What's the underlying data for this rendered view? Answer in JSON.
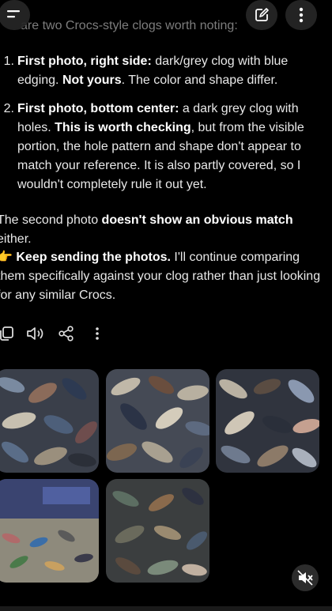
{
  "header": {
    "fade_text": "are two Crocs-style clogs worth noting:",
    "menu_icon": "hamburger-menu-icon",
    "edit_icon": "new-chat-edit-icon",
    "more_icon": "vertical-dots-icon"
  },
  "items": [
    {
      "number": "1.",
      "bold1": "First photo, right side:",
      "text1": " dark/grey clog with blue edging. ",
      "bold2": "Not yours",
      "text2": ". The color and shape differ."
    },
    {
      "number": "2.",
      "bold1": "First photo, bottom center:",
      "text1": " a dark grey clog with holes. ",
      "bold2": "This is worth checking",
      "text2": ", but from the visible portion, the hole pattern and shape don't appear to match your reference. It is also partly covered, so I wouldn't completely rule it out yet."
    }
  ],
  "para2": {
    "text1": "The second photo ",
    "bold": "doesn't show an obvious match",
    "text2": " either."
  },
  "para3": {
    "emoji": "👉",
    "bold": "Keep sending the photos.",
    "text": " I'll continue comparing them specifically against your clog rather than just looking for any similar Crocs."
  },
  "actions": {
    "copy_icon": "copy-icon",
    "listen_icon": "speaker-icon",
    "share_icon": "share-icon",
    "more_icon": "vertical-dots-icon"
  },
  "photos": [
    {
      "name": "shoe-pile-photo-1",
      "palette": [
        "#3c4a5a",
        "#8b6b5a",
        "#2d3a52",
        "#7a8aa0"
      ]
    },
    {
      "name": "shoe-pile-photo-2",
      "palette": [
        "#4a5060",
        "#c0b8a8",
        "#6a4e3e",
        "#2b3346"
      ]
    },
    {
      "name": "shoe-pile-photo-3",
      "palette": [
        "#2a2f3a",
        "#b9b1a2",
        "#5a4c42",
        "#8a98b0"
      ]
    },
    {
      "name": "shoe-pile-photo-4",
      "palette": [
        "#3a4470",
        "#b06a6a",
        "#3b6ea8",
        "#8e8a7c"
      ]
    },
    {
      "name": "shoe-pile-photo-5",
      "palette": [
        "#3b3e3f",
        "#5c6e62",
        "#8a6a4c",
        "#2d3140"
      ]
    }
  ],
  "mute_icon": "speaker-muted-icon",
  "colors": {
    "background": "#000000",
    "text": "#e8e8e8",
    "faded_text": "#7d7d7d",
    "button_bg": "#262626"
  }
}
